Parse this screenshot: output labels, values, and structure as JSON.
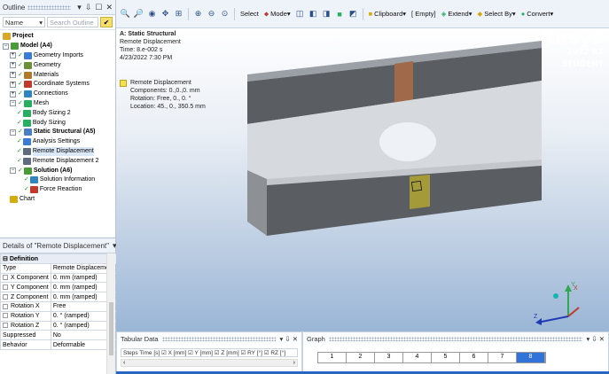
{
  "outline": {
    "title": "Outline",
    "controls": [
      "▾",
      "⇩",
      "☐",
      "✕"
    ],
    "filter_label": "Name",
    "search_placeholder": "Search Outline",
    "tree": [
      {
        "label": "Project",
        "bold": true,
        "icon_color": "#d9a72a",
        "exp": ""
      },
      {
        "label": "Model (A4)",
        "bold": true,
        "icon_color": "#4a9a3a",
        "exp": "−"
      },
      {
        "label": "Geometry Imports",
        "icon_color": "#3a7bd5",
        "exp": "+",
        "tick": true
      },
      {
        "label": "Geometry",
        "icon_color": "#6c8f3a",
        "exp": "+",
        "tick": true
      },
      {
        "label": "Materials",
        "icon_color": "#b07a2a",
        "exp": "+",
        "tick": true
      },
      {
        "label": "Coordinate Systems",
        "icon_color": "#c0392b",
        "exp": "+",
        "tick": true
      },
      {
        "label": "Connections",
        "icon_color": "#2e86c1",
        "exp": "+",
        "tick": true
      },
      {
        "label": "Mesh",
        "icon_color": "#27ae60",
        "exp": "−",
        "tick": true
      },
      {
        "label": "Body Sizing 2",
        "icon_color": "#27ae60",
        "exp": "",
        "tick": true,
        "indent": 2
      },
      {
        "label": "Body Sizing",
        "icon_color": "#27ae60",
        "exp": "",
        "tick": true,
        "indent": 2
      },
      {
        "label": "Static Structural (A5)",
        "bold": true,
        "icon_color": "#4a7fc2",
        "exp": "−",
        "tick": true
      },
      {
        "label": "Analysis Settings",
        "icon_color": "#3a7bd5",
        "exp": "",
        "tick": true,
        "indent": 2
      },
      {
        "label": "Remote Displacement",
        "icon_color": "#5d6d7e",
        "exp": "",
        "tick": true,
        "indent": 2,
        "selected": true
      },
      {
        "label": "Remote Displacement 2",
        "icon_color": "#5d6d7e",
        "exp": "",
        "tick": true,
        "indent": 2
      },
      {
        "label": "Solution (A6)",
        "bold": true,
        "icon_color": "#4a9a3a",
        "exp": "−",
        "tick": true,
        "indent": 1
      },
      {
        "label": "Solution Information",
        "icon_color": "#2e86c1",
        "exp": "",
        "tick": true,
        "indent": 3
      },
      {
        "label": "Force Reaction",
        "icon_color": "#c0392b",
        "exp": "",
        "tick": true,
        "indent": 3
      },
      {
        "label": "Chart",
        "icon_color": "#d4ac0d",
        "exp": "",
        "indent": 1
      }
    ]
  },
  "details": {
    "title": "Details of \"Remote Displacement\"",
    "controls": [
      "▾",
      "⇩",
      "☐",
      "✕"
    ],
    "section": "Definition",
    "rows": [
      {
        "key": "Type",
        "value": "Remote Displacement",
        "checkbox": false
      },
      {
        "key": "X Component",
        "value": "0. mm  (ramped)",
        "checkbox": true
      },
      {
        "key": "Y Component",
        "value": "0. mm  (ramped)",
        "checkbox": true
      },
      {
        "key": "Z Component",
        "value": "0. mm  (ramped)",
        "checkbox": true
      },
      {
        "key": "Rotation X",
        "value": "Free",
        "checkbox": true
      },
      {
        "key": "Rotation Y",
        "value": "0. °  (ramped)",
        "checkbox": true
      },
      {
        "key": "Rotation Z",
        "value": "0. °  (ramped)",
        "checkbox": true
      },
      {
        "key": "Suppressed",
        "value": "No",
        "checkbox": false
      },
      {
        "key": "Behavior",
        "value": "Deformable",
        "checkbox": false
      }
    ]
  },
  "toolbar": {
    "select_label": "Select",
    "mode_label": "Mode▾",
    "clipboard_label": "Clipboard▾",
    "empty_label": "[ Empty]",
    "extend_label": "Extend▾",
    "select_by_label": "Select By▾",
    "convert_label": "Convert▾"
  },
  "viewport": {
    "analysis_title": "A: Static Structural",
    "analysis_sub": "Remote Displacement",
    "time": "Time: 8.e-002 s",
    "date": "4/23/2022 7:30 PM",
    "legend_title": "Remote Displacement",
    "legend_lines": [
      "Components: 0.,0.,0. mm",
      "Rotation: Free, 0., 0. °",
      "Location: 45., 0., 350.5 mm"
    ],
    "legend_color": "#f5e24a",
    "brand": "Ansys",
    "version": "2022 R1",
    "edition": "STUDENT",
    "axis_y": "Y",
    "axis_z": "Z",
    "axis_x": "X"
  },
  "tabular": {
    "title": "Tabular Data",
    "header": "Steps  Time [s]  ☑ X [mm]  ☑ Y [mm]  ☑ Z [mm]  ☑ RY [°]  ☑ RZ [°]"
  },
  "graph": {
    "title": "Graph",
    "steps": [
      "1",
      "2",
      "3",
      "4",
      "5",
      "6",
      "7",
      "8"
    ],
    "active_step": 7
  }
}
